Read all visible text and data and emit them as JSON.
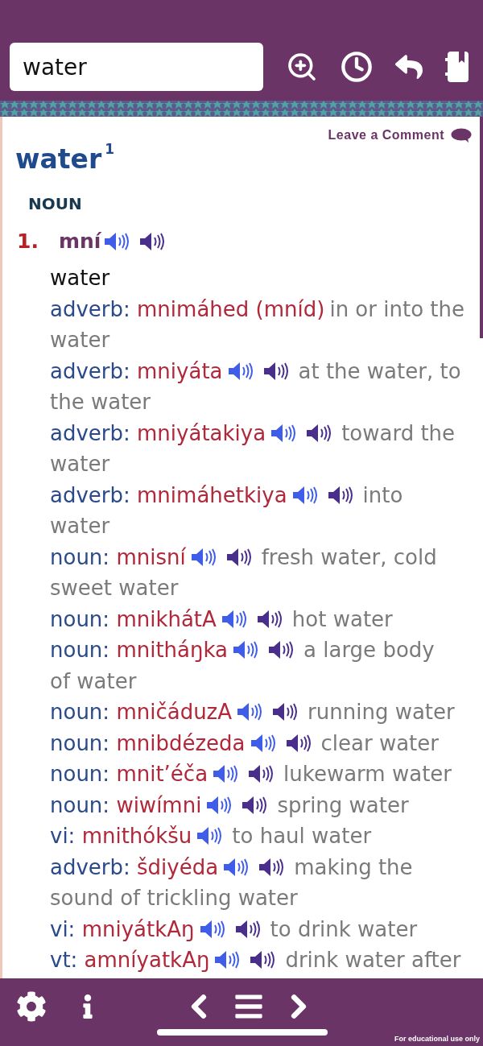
{
  "search": {
    "value": "water"
  },
  "comment_link": "Leave a Comment",
  "entry": {
    "headword": "water$^{1}$",
    "part_of_speech": "NOUN",
    "senses": [
      {
        "number": "1.",
        "lakota": "mní",
        "speakers": [
          {
            "color": "#3f5de8"
          },
          {
            "color": "#4a2e8c"
          }
        ],
        "gloss": "water",
        "related": [
          {
            "pos": "adverb:",
            "word": "mnimáhed (mníd)",
            "gloss_lines": [
              "in or into the",
              "water"
            ]
          },
          {
            "pos": "adverb:",
            "word": "mniyáta",
            "speakers": [
              {
                "color": "#3f5de8"
              },
              {
                "color": "#4a2e8c"
              }
            ],
            "gloss_lines": [
              "at the water, to",
              "the water"
            ]
          },
          {
            "pos": "adverb:",
            "word": "mniyátakiya",
            "speakers": [
              {
                "color": "#3f5de8"
              },
              {
                "color": "#4a2e8c"
              }
            ],
            "gloss_lines": [
              "toward the",
              "water"
            ]
          },
          {
            "pos": "adverb:",
            "word": "mnimáhetkiya",
            "speakers": [
              {
                "color": "#3f5de8"
              },
              {
                "color": "#4a2e8c"
              }
            ],
            "gloss_lines": [
              "into",
              "water"
            ]
          },
          {
            "pos": "noun:",
            "word": "mnisní",
            "speakers": [
              {
                "color": "#3f5de8"
              },
              {
                "color": "#4a2e8c"
              }
            ],
            "gloss_lines": [
              "fresh water, cold",
              "sweet water"
            ]
          },
          {
            "pos": "noun:",
            "word": "mnikhátA",
            "speakers": [
              {
                "color": "#3f5de8"
              },
              {
                "color": "#4a2e8c"
              }
            ],
            "gloss_lines": [
              "hot water"
            ]
          },
          {
            "pos": "noun:",
            "word": "mnitháŋka",
            "speakers": [
              {
                "color": "#3f5de8"
              },
              {
                "color": "#4a2e8c"
              }
            ],
            "gloss_lines": [
              "a large body",
              "of water"
            ]
          },
          {
            "pos": "noun:",
            "word": "mničáduzA",
            "speakers": [
              {
                "color": "#3f5de8"
              },
              {
                "color": "#4a2e8c"
              }
            ],
            "gloss_lines": [
              "running water"
            ]
          },
          {
            "pos": "noun:",
            "word": "mnibdézeda",
            "speakers": [
              {
                "color": "#3f5de8"
              },
              {
                "color": "#4a2e8c"
              }
            ],
            "gloss_lines": [
              "clear water"
            ]
          },
          {
            "pos": "noun:",
            "word": "mnit’éča",
            "speakers": [
              {
                "color": "#3f5de8"
              },
              {
                "color": "#4a2e8c"
              }
            ],
            "gloss_lines": [
              "lukewarm water"
            ]
          },
          {
            "pos": "noun:",
            "word": "wiwímni",
            "speakers": [
              {
                "color": "#3f5de8"
              },
              {
                "color": "#4a2e8c"
              }
            ],
            "gloss_lines": [
              "spring water"
            ]
          },
          {
            "pos": "vi:",
            "word": "mnithókšu",
            "speakers": [
              {
                "color": "#3f5de8"
              }
            ],
            "gloss_lines": [
              "to haul water"
            ]
          },
          {
            "pos": "adverb:",
            "word": "šdiyéda",
            "speakers": [
              {
                "color": "#3f5de8"
              },
              {
                "color": "#4a2e8c"
              }
            ],
            "gloss_lines": [
              "making the",
              "sound of trickling water"
            ]
          },
          {
            "pos": "vi:",
            "word": "mniyátkAŋ",
            "speakers": [
              {
                "color": "#3f5de8"
              },
              {
                "color": "#4a2e8c"
              }
            ],
            "gloss_lines": [
              "to drink water"
            ]
          },
          {
            "pos": "vt:",
            "word": "amníyatkAŋ",
            "speakers": [
              {
                "color": "#3f5de8"
              },
              {
                "color": "#4a2e8c"
              }
            ],
            "gloss_lines": [
              "drink water after"
            ]
          }
        ]
      }
    ]
  },
  "footer_note": "For educational use only"
}
